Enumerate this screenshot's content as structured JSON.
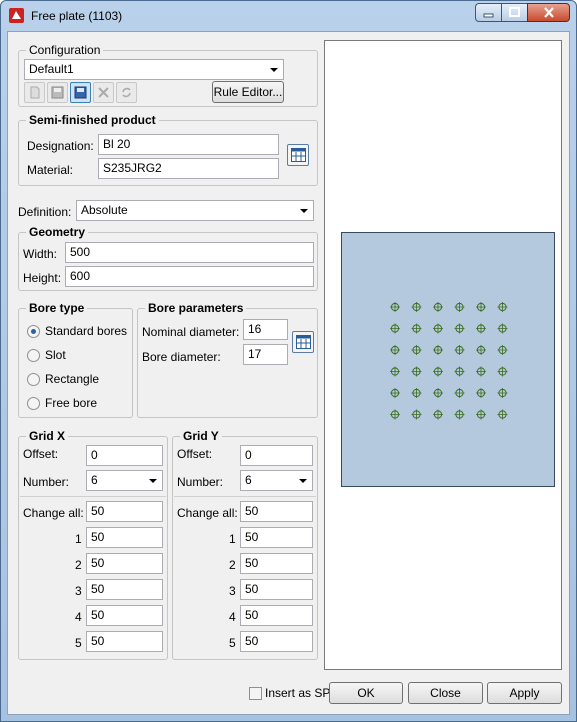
{
  "window": {
    "title": "Free plate (1103)"
  },
  "config": {
    "label": "Configuration",
    "selected": "Default1",
    "rule_editor": "Rule Editor...",
    "toolbar_icons": [
      "new-icon",
      "save-icon",
      "save-as-icon",
      "delete-icon",
      "refresh-icon"
    ]
  },
  "semi": {
    "label": "Semi-finished product",
    "designation_label": "Designation:",
    "designation": "Bl 20",
    "material_label": "Material:",
    "material": "S235JRG2"
  },
  "definition": {
    "label": "Definition:",
    "value": "Absolute"
  },
  "geometry": {
    "label": "Geometry",
    "width_label": "Width:",
    "width": "500",
    "height_label": "Height:",
    "height": "600"
  },
  "bore_type": {
    "label": "Bore type",
    "options": [
      "Standard bores",
      "Slot",
      "Rectangle",
      "Free bore"
    ],
    "selected_index": 0
  },
  "bore_params": {
    "label": "Bore parameters",
    "nominal_label": "Nominal diameter:",
    "nominal": "16",
    "bore_label": "Bore diameter:",
    "bore": "17"
  },
  "grid_x": {
    "label": "Grid X",
    "offset_label": "Offset:",
    "offset": "0",
    "number_label": "Number:",
    "number": "6",
    "change_all_label": "Change all:",
    "change_all": "50",
    "rows": [
      {
        "index": "1",
        "value": "50"
      },
      {
        "index": "2",
        "value": "50"
      },
      {
        "index": "3",
        "value": "50"
      },
      {
        "index": "4",
        "value": "50"
      },
      {
        "index": "5",
        "value": "50"
      }
    ]
  },
  "grid_y": {
    "label": "Grid Y",
    "offset_label": "Offset:",
    "offset": "0",
    "number_label": "Number:",
    "number": "6",
    "change_all_label": "Change all:",
    "change_all": "50",
    "rows": [
      {
        "index": "1",
        "value": "50"
      },
      {
        "index": "2",
        "value": "50"
      },
      {
        "index": "3",
        "value": "50"
      },
      {
        "index": "4",
        "value": "50"
      },
      {
        "index": "5",
        "value": "50"
      }
    ]
  },
  "footer": {
    "insert_as_sp": "Insert as SP",
    "ok": "OK",
    "close": "Close",
    "apply": "Apply"
  },
  "preview": {
    "bore_columns": 6,
    "bore_rows": 6,
    "plate_color": "#b4c8de",
    "bore_color": "#3a6e1e"
  }
}
